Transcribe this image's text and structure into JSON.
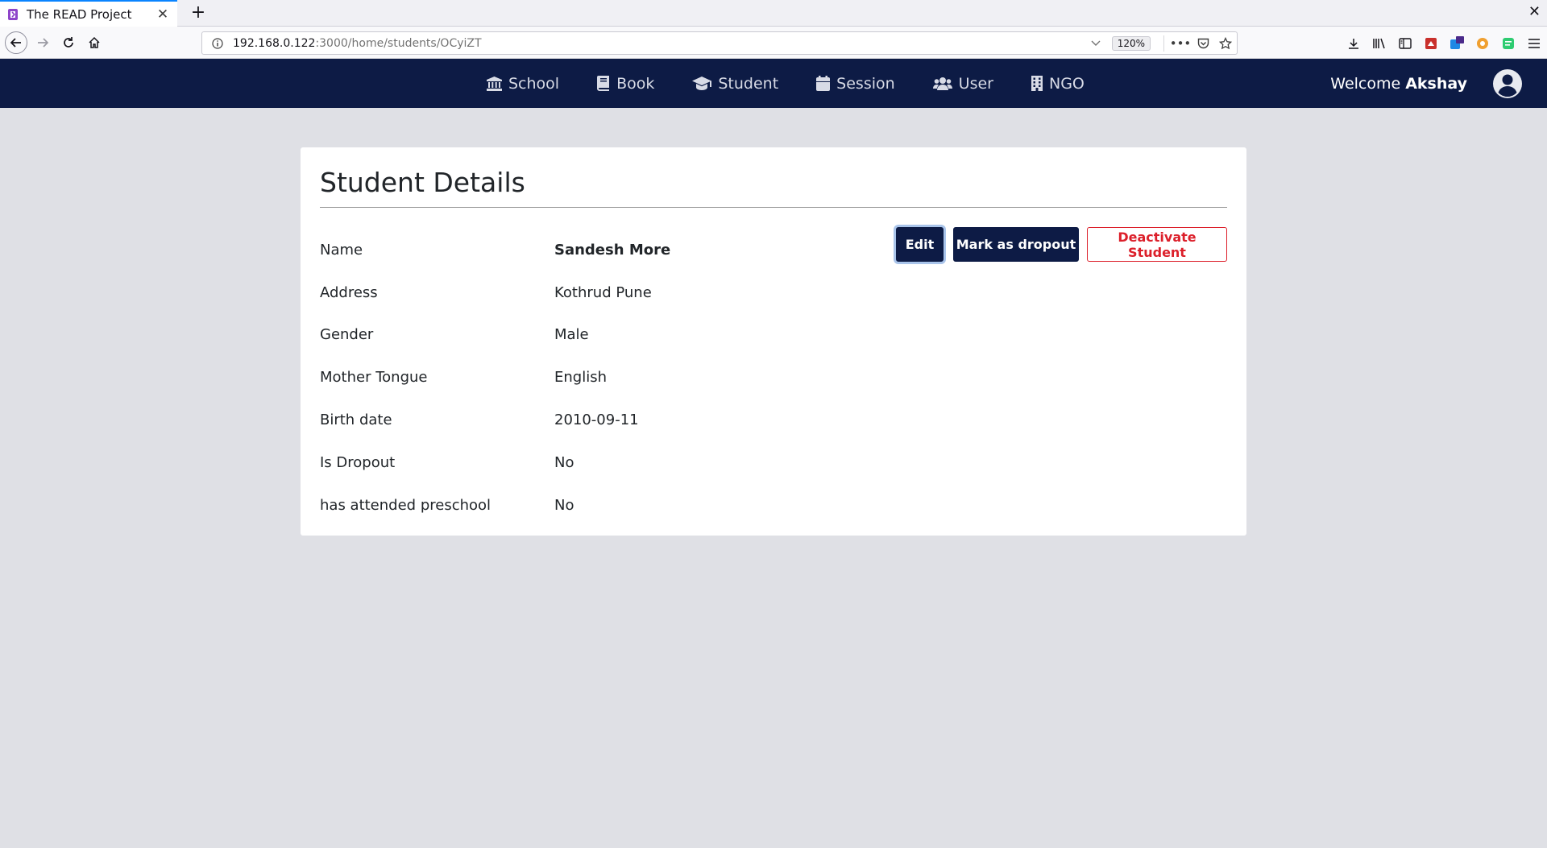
{
  "browser": {
    "tab_title": "The READ Project",
    "new_tab_label": "+",
    "close_tab_label": "✕",
    "window_close_label": "✕",
    "url_host": "192.168.0.122",
    "url_path": ":3000/home/students/OCyiZT",
    "zoom": "120%",
    "page_actions_label": "•••"
  },
  "nav": {
    "items": [
      {
        "label": "School",
        "icon": "school-icon"
      },
      {
        "label": "Book",
        "icon": "book-icon"
      },
      {
        "label": "Student",
        "icon": "graduation-cap-icon"
      },
      {
        "label": "Session",
        "icon": "calendar-icon"
      },
      {
        "label": "User",
        "icon": "users-icon"
      },
      {
        "label": "NGO",
        "icon": "building-icon"
      }
    ],
    "welcome_text": "Welcome",
    "user_name": "Akshay"
  },
  "details": {
    "title": "Student Details",
    "rows": [
      {
        "label": "Name",
        "value": "Sandesh More"
      },
      {
        "label": "Address",
        "value": "Kothrud Pune"
      },
      {
        "label": "Gender",
        "value": "Male"
      },
      {
        "label": "Mother Tongue",
        "value": "English"
      },
      {
        "label": "Birth date",
        "value": "2010-09-11"
      },
      {
        "label": "Is Dropout",
        "value": "No"
      },
      {
        "label": "has attended preschool",
        "value": "No"
      }
    ],
    "actions": {
      "edit": "Edit",
      "dropout": "Mark as dropout",
      "deactivate": "Deactivate Student"
    }
  },
  "colors": {
    "navbar": "#0d1b45",
    "page_bg": "#dfe0e5",
    "danger": "#dc1f2a"
  }
}
